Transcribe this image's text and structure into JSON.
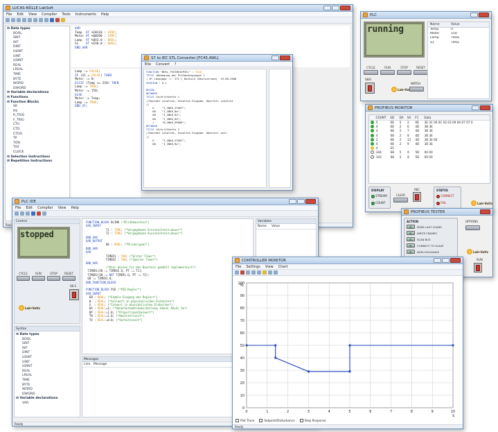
{
  "lucas": {
    "title": "LUCAS-NÜLLE LabSoft",
    "menu": [
      "File",
      "Edit",
      "View",
      "Compiler",
      "Tools",
      "Instruments",
      "Help"
    ],
    "tree": [
      {
        "t": "Data types",
        "g": true
      },
      {
        "t": "BOOL"
      },
      {
        "t": "SINT"
      },
      {
        "t": "INT"
      },
      {
        "t": "DINT"
      },
      {
        "t": "USINT"
      },
      {
        "t": "UINT"
      },
      {
        "t": "UDINT"
      },
      {
        "t": "REAL"
      },
      {
        "t": "LREAL"
      },
      {
        "t": "TIME"
      },
      {
        "t": "BYTE"
      },
      {
        "t": "WORD"
      },
      {
        "t": "DWORD"
      },
      {
        "t": "Variable declarations",
        "g": true
      },
      {
        "t": "Functions",
        "g": true
      },
      {
        "t": "Function Blocks",
        "g": true
      },
      {
        "t": "SR"
      },
      {
        "t": "RS"
      },
      {
        "t": "R_TRIG"
      },
      {
        "t": "F_TRIG"
      },
      {
        "t": "CTU"
      },
      {
        "t": "CTD"
      },
      {
        "t": "CTUD"
      },
      {
        "t": "TP"
      },
      {
        "t": "TON"
      },
      {
        "t": "TOF"
      },
      {
        "t": "CLOCK"
      },
      {
        "t": "Selection Instructions",
        "g": true
      },
      {
        "t": "Repetition Instructions",
        "g": true
      }
    ],
    "code_top": "VAR\nTemp  AT %IW110 : UINT;\nMotor AT %QW200 : UINT;\nLamp  AT %QX3.0 : BOOL;\nS1    AT %IX0.0 : BOOL;\nEND_VAR",
    "code_bottom": "Lamp := FALSE;\nIF (S1 = FALSE) THEN\nMotor := 0;\nELSIF (Temp <= 250) THEN\nLamp := TRUE;\nMotor := 150;\nELSE\nMotor := Temp;\nLamp := TRUE;\nEND_IF;",
    "status": "Ready"
  },
  "converter": {
    "title": "S7 to IEC STL Converter [FC45.AWL]",
    "menu": [
      "Eile",
      "Convert",
      "?"
    ],
    "code": "FUNCTION \"BEKL_TESTBEISPIEL\" : VOID\nTITLE =Bewegung der Prüfbedingungen 1\n( #*_language := 'ITL') Deutsch (Deutschland)  19.08.2008\nVERSION : 0.1\n\nBEGIN\nNETWORK\nTITLE =Schrittkette 1\n//Kontakt schalten, Schalten Eingabe, Oberteil schaltet\n//\n    U     \"I_INK6_START\";\n    UN    \"I_INK6_Bo\";\n    UN    \"I_INK6_B2\";\n    UN    \"I_INK6_B4\";\n    =     \"M_INK6_ERROR\";\nNETWORK\nTITLE =Schrittkette 2\n//Kontakt schalten, Schalten Eingabe, Oberteil weil\n//\n    U     \"I_INK6_START\";\n    UN    \"I_INK6_Bo\";"
  },
  "plc1": {
    "title": "PLC",
    "lcd": "running",
    "buttons": [
      "CYCLE",
      "RUN",
      "STOP",
      "RESET"
    ],
    "sw": "S8/S",
    "logo": "Lab•Voltz",
    "watch": "WATCH",
    "cols": [
      "Name",
      "Value"
    ],
    "rows": [
      [
        "Temp",
        "0"
      ],
      [
        "Motor",
        "150"
      ],
      [
        "Lamp",
        "TRUE"
      ],
      [
        "S1",
        "TRUE"
      ]
    ]
  },
  "profibus": {
    "title": "PROFIBUS MONITOR",
    "cols": [
      "COUNT",
      "SD",
      "DA",
      "SA",
      "FC",
      "Data"
    ],
    "rows": [
      {
        "d": "g",
        "c": [
          "5",
          "68",
          "5",
          "2",
          "08",
          "3E 3C 00 0C 02 03 09 0A 07 07 0"
        ]
      },
      {
        "d": "g",
        "c": [
          "4",
          "68",
          "2",
          "6",
          "4D",
          "3B 3E"
        ]
      },
      {
        "d": "g",
        "c": [
          "4",
          "68",
          "2",
          "7",
          "4D",
          "3B 3E"
        ]
      },
      {
        "d": "g",
        "c": [
          "4",
          "68",
          "2",
          "8",
          "4D",
          "3B 3E"
        ]
      },
      {
        "d": "g",
        "c": [
          "2",
          "68",
          "2",
          "12",
          "4D",
          "3B 3E 00"
        ]
      },
      {
        "d": "g",
        "c": [
          "4",
          "68",
          "2",
          "9",
          "4D",
          "3B 3E"
        ]
      },
      {
        "d": "y",
        "c": [
          "4",
          "E5",
          "",
          "",
          "",
          ""
        ]
      },
      {
        "d": "b",
        "c": [
          "344",
          "68",
          "5",
          "6",
          "5D",
          "00 00"
        ]
      },
      {
        "d": "b",
        "c": [
          "343",
          "68",
          "5",
          "8",
          "5D",
          "00 00"
        ]
      }
    ],
    "display": "DISPLAY",
    "opts": [
      "STREAM",
      "COUNT"
    ],
    "clear": "CLEAR",
    "rec": "REC",
    "status": "STATUS",
    "s1": "CONNECT",
    "s2": "FAIL"
  },
  "tester": {
    "title": "PROFIBUS TESTER",
    "action": "ACTION",
    "actions": [
      "SEND LAST CHARS",
      "WRITE FRAMES",
      "SCAN BUS",
      "CONNECT TO SLAVE",
      "DATA EXCHANGE",
      "ENABLE WATCHDOG"
    ],
    "options": "OPTIONS",
    "run": "RUN"
  },
  "plcide": {
    "title": "PLC IDE",
    "menu": [
      "File",
      "Edit",
      "Compiler",
      "View",
      "Help"
    ],
    "control": "Control",
    "lcd": "stopped",
    "buttons": [
      "CYCLE",
      "RUN",
      "STOP",
      "RESET"
    ],
    "sw": "S8 S",
    "syntax": "Syntax",
    "tree": [
      {
        "t": "Data types",
        "g": true
      },
      {
        "t": "BOOL"
      },
      {
        "t": "SINT"
      },
      {
        "t": "INT"
      },
      {
        "t": "DINT"
      },
      {
        "t": "USINT"
      },
      {
        "t": "UINT"
      },
      {
        "t": "UDINT"
      },
      {
        "t": "REAL"
      },
      {
        "t": "LREAL"
      },
      {
        "t": "TIME"
      },
      {
        "t": "BYTE"
      },
      {
        "t": "WORD"
      },
      {
        "t": "DWORD"
      },
      {
        "t": "Variable declarations",
        "g": true
      },
      {
        "t": "VAR"
      }
    ],
    "code": "FUNCTION_BLOCK BLINK (*Blinkbaustein*)\nVAR_INPUT\n            T1 : TIME; (*Vorgegebene Einschaltzeit=dauer*)\n            T2 : TIME; (*Vorgegebene Ausschaltzeit=dauer*)\nEND_VAR\nVAR_OUTPUT\n            Q0 : BOOL; (*Blinksignal*)\nEND_VAR\nVAR\n            TIMER1 : TON; (*Erster Timer*)\n            TIMER2 : TON; (*Zweiter Timer*)\nEND_VAR\n            (*Hier müssen fur den Baustein gewählt implementiert*)\n TIMER1(IN := TIMER2.Q, PT := T1);\n TIMER2(IN := NOT TIMER1.Q, PT := T2);\n Q0 := TIMER1.Q;\nEND_FUNCTION_BLOCK\n\nFUNCTION_BLOCK PID (*PID-Regler*)\nVAR_INPUT\n  EN : BOOL; (*Enable Eingang des Reglers*)\n  W  : REAL; (*Sollwert in physikalischen Einheiten*)\n  X  : REAL; (*Istwert in physikalischen Einheiten*)\n  HA : BOOL:=1; (*Hand/Automatikumschaltung (Hand: HA=0; Au*)\n  KP : REAL:=1.0; (*Proportionalbeiwert*)\n  TN : REAL:=1.0; (*Nachstellzeit*)\n  TV : REAL:=0.0; (*Vorhaltezeit*)",
    "vars": "Variables",
    "vcols": [
      "Name",
      "Value"
    ],
    "messages": "Messages",
    "mcols": [
      "Line",
      "Message"
    ],
    "status": "Ready"
  },
  "controller": {
    "title": "CONTROLLER MONITOR",
    "menu": [
      "File",
      "Settings",
      "View",
      "Chart"
    ],
    "ylabel": "%",
    "xlabel": "s",
    "legend": [
      "Plot Trace",
      "Setpoint/Disturbance",
      "Step Response"
    ],
    "status": "Ready"
  },
  "chart_data": {
    "type": "line",
    "xlabel": "s",
    "ylabel": "%",
    "xlim": [
      0,
      10
    ],
    "ylim": [
      0,
      100
    ],
    "xticks": [
      0,
      1,
      2,
      3,
      4,
      5,
      6,
      7,
      8,
      9,
      10
    ],
    "yticks": [
      0,
      10,
      20,
      30,
      40,
      50,
      60,
      70,
      80,
      90,
      100
    ],
    "grid": true,
    "series": [
      {
        "color": "#1f3fbf",
        "x": [
          0,
          1.4,
          1.4,
          3,
          5,
          5,
          10
        ],
        "y": [
          50,
          50,
          40,
          29,
          29,
          50,
          50
        ]
      }
    ]
  }
}
